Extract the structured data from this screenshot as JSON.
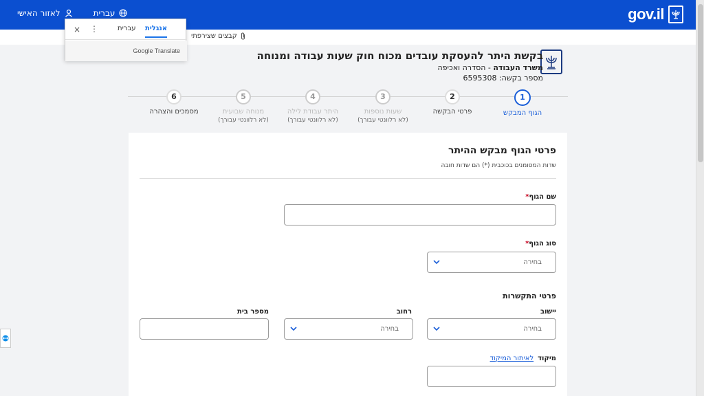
{
  "header": {
    "logo_text": "gov.il",
    "personal_area": "לאזור האישי",
    "language": "עברית"
  },
  "subbar": {
    "attachments": "קבצים שצירפתי"
  },
  "translate_popup": {
    "tab_english": "אנגלית",
    "tab_hebrew": "עברית",
    "brand": "Google Translate",
    "close": "×",
    "menu": "⋮"
  },
  "page": {
    "title": "בקשת היתר להעסקת עובדים מכוח חוק שעות עבודה ומנוחה",
    "ministry_name": "משרד העבודה",
    "ministry_unit": " - הסדרה ואכיפה",
    "request_label": "מספר בקשה:",
    "request_number": "6595308"
  },
  "steps": [
    {
      "num": "1",
      "label": "הגוף המבקש",
      "sub": ""
    },
    {
      "num": "2",
      "label": "פרטי הבקשה",
      "sub": ""
    },
    {
      "num": "3",
      "label": "שעות נוספות",
      "sub": "(לא רלוונטי עבורך)"
    },
    {
      "num": "4",
      "label": "היתר עבודת לילה",
      "sub": "(לא רלוונטי עבורך)"
    },
    {
      "num": "5",
      "label": "מנוחה שבועית",
      "sub": "(לא רלוונטי עבורך)"
    },
    {
      "num": "6",
      "label": "מסמכים והצהרה",
      "sub": ""
    }
  ],
  "form": {
    "title": "פרטי הגוף מבקש ההיתר",
    "note": "שדות המסומנים בכוכבית (*) הם שדות חובה",
    "body_name_label": "שם הגוף",
    "body_type_label": "סוג הגוף",
    "required_mark": "*",
    "select_placeholder": "בחירה",
    "contact_section": "פרטי התקשרות",
    "city_label": "יישוב",
    "street_label": "רחוב",
    "house_number_label": "מספר בית",
    "zip_label": "מיקוד",
    "zip_link": "לאיתור המיקוד"
  }
}
